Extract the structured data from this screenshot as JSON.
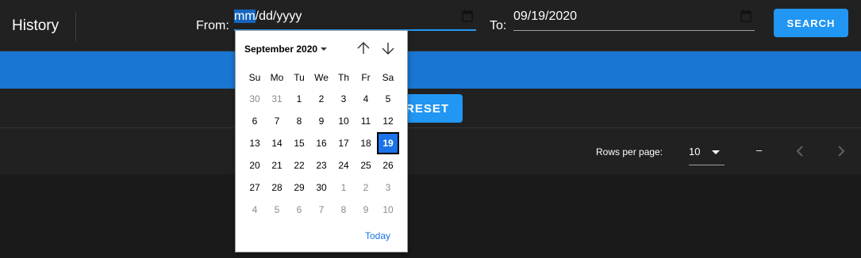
{
  "toolbar": {
    "title": "History",
    "from_label": "From:",
    "from_placeholder_hl": "mm",
    "from_placeholder_rest": "/dd/yyyy",
    "to_label": "To:",
    "to_value": "09/19/2020",
    "search_label": "SEARCH"
  },
  "filters": {
    "reset_label": "RESET"
  },
  "pagination": {
    "rows_per_page_label": "Rows per page:",
    "rows_per_page_value": "10",
    "range_text": "–"
  },
  "calendar": {
    "month_label": "September 2020",
    "today_label": "Today",
    "weekdays": [
      "Su",
      "Mo",
      "Tu",
      "We",
      "Th",
      "Fr",
      "Sa"
    ],
    "weeks": [
      [
        {
          "d": "30",
          "dim": true
        },
        {
          "d": "31",
          "dim": true
        },
        {
          "d": "1"
        },
        {
          "d": "2"
        },
        {
          "d": "3"
        },
        {
          "d": "4"
        },
        {
          "d": "5"
        }
      ],
      [
        {
          "d": "6"
        },
        {
          "d": "7"
        },
        {
          "d": "8"
        },
        {
          "d": "9"
        },
        {
          "d": "10"
        },
        {
          "d": "11"
        },
        {
          "d": "12"
        }
      ],
      [
        {
          "d": "13"
        },
        {
          "d": "14"
        },
        {
          "d": "15"
        },
        {
          "d": "16"
        },
        {
          "d": "17"
        },
        {
          "d": "18"
        },
        {
          "d": "19",
          "today": true
        }
      ],
      [
        {
          "d": "20"
        },
        {
          "d": "21"
        },
        {
          "d": "22"
        },
        {
          "d": "23"
        },
        {
          "d": "24"
        },
        {
          "d": "25"
        },
        {
          "d": "26"
        }
      ],
      [
        {
          "d": "27"
        },
        {
          "d": "28"
        },
        {
          "d": "29"
        },
        {
          "d": "30"
        },
        {
          "d": "1",
          "dim": true
        },
        {
          "d": "2",
          "dim": true
        },
        {
          "d": "3",
          "dim": true
        }
      ],
      [
        {
          "d": "4",
          "dim": true
        },
        {
          "d": "5",
          "dim": true
        },
        {
          "d": "6",
          "dim": true
        },
        {
          "d": "7",
          "dim": true
        },
        {
          "d": "8",
          "dim": true
        },
        {
          "d": "9",
          "dim": true
        },
        {
          "d": "10",
          "dim": true
        }
      ]
    ]
  },
  "colors": {
    "accent": "#2196f3",
    "band": "#1976d2",
    "background": "#1a1a1a",
    "surface": "#212121",
    "selected_day": "#1a73e8"
  },
  "icons": {
    "calendar": "calendar-icon",
    "arrow_up": "arrow-up-icon",
    "arrow_down": "arrow-down-icon",
    "prev": "chevron-left-icon",
    "next": "chevron-right-icon"
  }
}
